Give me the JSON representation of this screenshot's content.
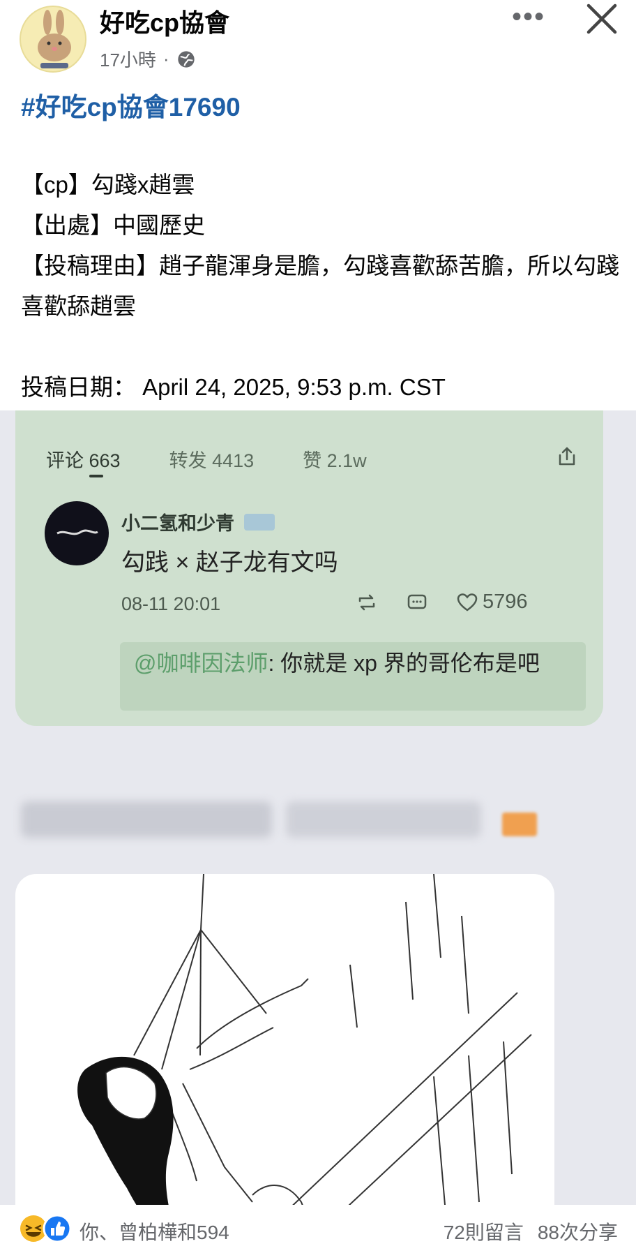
{
  "header": {
    "page_name": "好吃cp協會",
    "time": "17小時",
    "separator": "·",
    "more_icon": "more-horizontal-icon",
    "close_icon": "close-icon",
    "privacy_icon": "globe-icon"
  },
  "post": {
    "hashtag": "#好吃cp協會17690",
    "lines": {
      "cp": "【cp】勾踐x趙雲",
      "source": "【出處】中國歷史",
      "reason": "【投稿理由】趙子龍渾身是膽，勾踐喜歡舔苦膽，所以勾踐喜歡舔趙雲",
      "date": "投稿日期：   April 24, 2025, 9:53 p.m. CST"
    }
  },
  "image": {
    "stats": {
      "comments": "评论 663",
      "reposts": "转发 4413",
      "likes": "赞 2.1w"
    },
    "comment": {
      "user": "小二氢和少青",
      "text": "勾践 × 赵子龙有文吗",
      "date": "08-11 20:01",
      "like_count": "5796"
    },
    "reply": {
      "user": "@咖啡因法师",
      "text": ": 你就是 xp 界的哥伦布是吧"
    }
  },
  "footer": {
    "reaction_names": "你、曾柏樺和594",
    "comments_count": "72則留言",
    "shares_count": "88次分享",
    "colors": {
      "haha": "#f7b928",
      "like": "#1877f2"
    }
  }
}
